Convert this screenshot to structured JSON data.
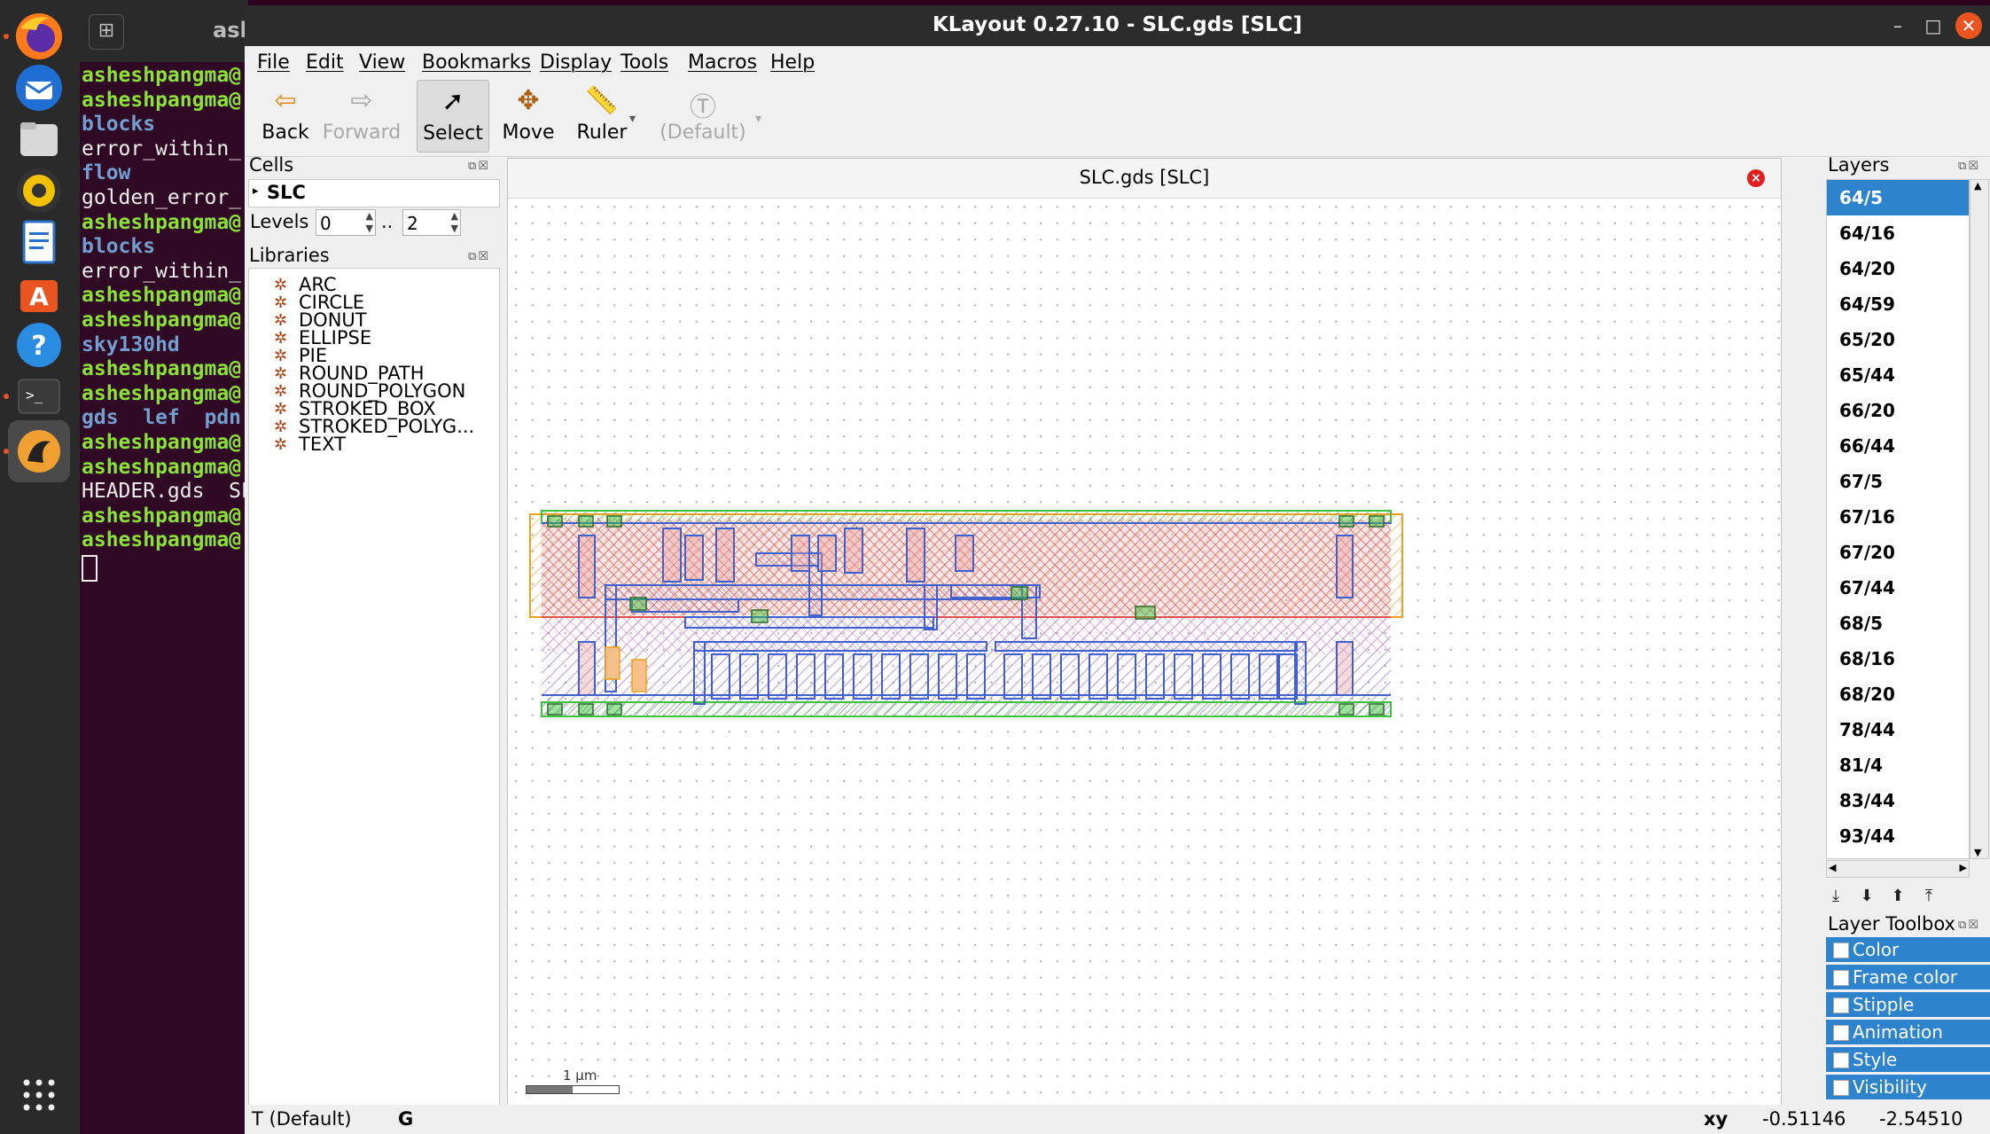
{
  "dock": {
    "items": [
      "firefox-icon",
      "thunderbird-icon",
      "files-icon",
      "rhythmbox-icon",
      "libreoffice-writer-icon",
      "software-center-icon",
      "help-icon",
      "terminal-icon",
      "klayout-icon"
    ],
    "apps_grid_icon": "apps-grid-icon"
  },
  "terminal": {
    "title": "ash",
    "lines": [
      {
        "text": "asheshpangma@",
        "style": "g"
      },
      {
        "text": "asheshpangma@",
        "style": "g"
      },
      {
        "text": "blocks",
        "style": "b"
      },
      {
        "text": "error_within_",
        "style": "w"
      },
      {
        "text": "flow",
        "style": "b"
      },
      {
        "text": "golden_error_",
        "style": "w"
      },
      {
        "text": "asheshpangma@",
        "style": "g"
      },
      {
        "text": "blocks",
        "style": "b"
      },
      {
        "text": "error_within_",
        "style": "w"
      },
      {
        "text": "asheshpangma@",
        "style": "g"
      },
      {
        "text": "asheshpangma@",
        "style": "g"
      },
      {
        "text": "sky130hd",
        "style": "b"
      },
      {
        "text": "asheshpangma@",
        "style": "g"
      },
      {
        "text": "asheshpangma@",
        "style": "g"
      },
      {
        "text": "gds  lef  pdn",
        "style": "b"
      },
      {
        "text": "asheshpangma@",
        "style": "g"
      },
      {
        "text": "asheshpangma@",
        "style": "g"
      },
      {
        "text": "HEADER.gds  SL",
        "style": "w"
      },
      {
        "text": "asheshpangma@",
        "style": "g"
      },
      {
        "text": "asheshpangma@",
        "style": "g"
      }
    ]
  },
  "window": {
    "title": "KLayout 0.27.10 - SLC.gds [SLC]",
    "controls": {
      "minimize": "–",
      "maximize": "□",
      "close": "✕"
    }
  },
  "menu": [
    "File",
    "Edit",
    "View",
    "Bookmarks",
    "Display",
    "Tools",
    "Macros",
    "Help"
  ],
  "toolbar": {
    "back": "Back",
    "forward": "Forward",
    "select": "Select",
    "move": "Move",
    "ruler": "Ruler",
    "text_default": "(Default)"
  },
  "cells": {
    "title": "Cells",
    "top_cell": "SLC",
    "levels_label": "Levels",
    "levels_from": "0",
    "levels_sep": "..",
    "levels_to": "2"
  },
  "libraries": {
    "title": "Libraries",
    "items": [
      "ARC",
      "CIRCLE",
      "DONUT",
      "ELLIPSE",
      "PIE",
      "ROUND_PATH",
      "ROUND_POLYGON",
      "STROKED_BOX",
      "STROKED_POLYG...",
      "TEXT"
    ]
  },
  "view": {
    "tab_title": "SLC.gds [SLC]",
    "scale_label": "1 µm"
  },
  "layers": {
    "title": "Layers",
    "items": [
      "64/5",
      "64/16",
      "64/20",
      "64/59",
      "65/20",
      "65/44",
      "66/20",
      "66/44",
      "67/5",
      "67/16",
      "67/20",
      "67/44",
      "68/5",
      "68/16",
      "68/20",
      "78/44",
      "81/4",
      "83/44",
      "93/44"
    ],
    "selected": "64/5"
  },
  "toolbox": {
    "title": "Layer Toolbox",
    "items": [
      "Color",
      "Frame color",
      "Stipple",
      "Animation",
      "Style",
      "Visibility"
    ]
  },
  "status": {
    "text_mode": "T (Default)",
    "grid": "G",
    "xy_label": "xy",
    "x": "-0.51146",
    "y": "-2.54510"
  },
  "colors": {
    "selection": "#2d83cc",
    "pwell_hatch": "#e05050",
    "nwell_hatch": "#9a5cd8",
    "boundary": "#f0a020",
    "power_rail": "#40c040",
    "metal": "#4060d0"
  }
}
